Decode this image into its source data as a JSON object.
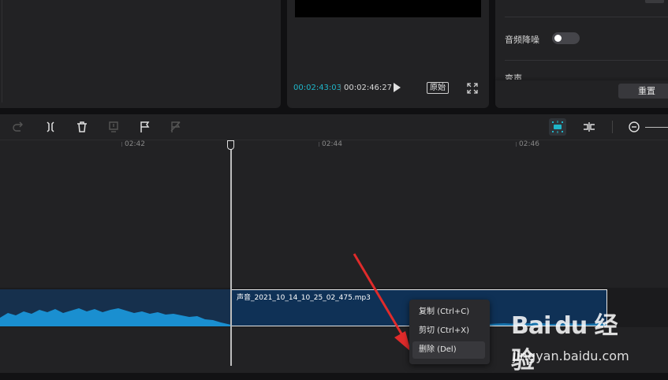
{
  "player": {
    "time_current": "00:02:43:03",
    "time_separator": "|",
    "time_total": "00:02:46:27",
    "ratio_label": "原始"
  },
  "properties": {
    "noise_reduction_label": "音频降噪",
    "noise_reduction_on": false,
    "voice_change_label": "变声",
    "reset_label": "重置"
  },
  "toolbar": {
    "icons": [
      "redo-icon",
      "split-icon",
      "delete-icon",
      "freeze-icon",
      "flag-icon",
      "flag-disabled-icon",
      "snap-icon",
      "link-icon",
      "zoom-out-icon"
    ]
  },
  "ruler": {
    "labels": [
      "02:42",
      "02:44",
      "02:46"
    ]
  },
  "clip": {
    "name": "声音_2021_10_14_10_25_02_475.mp3"
  },
  "context_menu": {
    "copy": "复制 (Ctrl+C)",
    "cut": "剪切 (Ctrl+X)",
    "delete": "删除 (Del)"
  },
  "watermark": {
    "logo": "Bai du 经验",
    "url": "jingyan.baidu.com"
  },
  "colors": {
    "accent": "#1fb6c9",
    "waveform": "#1a8fd0",
    "clip_bg": "#0f3156",
    "arrow": "#e02b2b"
  }
}
